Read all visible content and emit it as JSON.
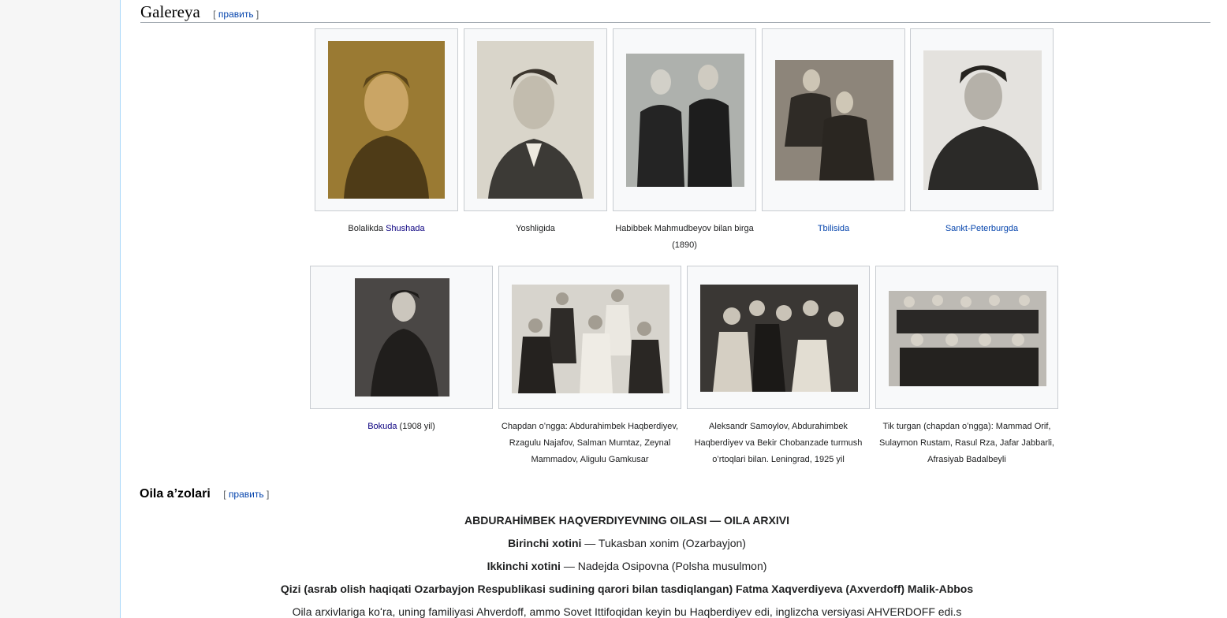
{
  "gallery": {
    "heading": "Galereya",
    "edit": "править",
    "items": [
      {
        "pre": "Bolalikda ",
        "link": "Shushada",
        "post": ""
      },
      {
        "pre": "Yoshligida",
        "link": "",
        "post": ""
      },
      {
        "pre": "Habibbek Mahmudbeyov bilan birga (1890)",
        "link": "",
        "post": ""
      },
      {
        "pre": "",
        "link": "Tbilisida",
        "post": ""
      },
      {
        "pre": "",
        "link": "Sankt-Peterburgda",
        "post": ""
      },
      {
        "pre": "",
        "link": "Bokuda",
        "post": " (1908 yil)"
      },
      {
        "pre": "Chapdan oʻngga: Abdurahimbek Haqberdiyev, Rzagulu Najafov, Salman Mumtaz, Zeynal Mammadov, Aligulu Gamkusar",
        "link": "",
        "post": ""
      },
      {
        "pre": "Aleksandr Samoylov, Abdurahimbek Haqberdiyev va Bekir Chobanzade turmush oʻrtoqlari bilan. Leningrad, 1925 yil",
        "link": "",
        "post": ""
      },
      {
        "pre": "Tik turgan (chapdan oʻngga): Mammad Orif, Sulaymon Rustam, Rasul Rza, Jafar Jabbarli, Afrasiyab Badalbeyli",
        "link": "",
        "post": ""
      }
    ]
  },
  "family": {
    "heading": "Oila a’zolari",
    "edit": "править",
    "title": "ABDURAHİMBEK HAQVERDIYEVNING OILASI — OILA ARXIVI",
    "wife1_label": "Birinchi xotini",
    "wife1_value": " — Tukasban xonim (Ozarbayjon)",
    "wife2_label": "Ikkinchi xotini",
    "wife2_value": " — Nadejda Osipovna (Polsha musulmon)",
    "daughter": "Qizi (asrab olish haqiqati Ozarbayjon Respublikasi sudining qarori bilan tasdiqlangan) Fatma Xaqverdiyeva (Axverdoff) Malik-Abbos",
    "archive_note": "Oila arxivlariga koʻra, uning familiyasi Ahverdoff, ammo Sovet Ittifoqidan keyin bu Haqberdiyev edi, inglizcha versiyasi AHVERDOFF edi.s"
  },
  "colors": {
    "link": "#0645ad",
    "border": "#c8ccd1",
    "thumb_bg": "#f8f9fa"
  }
}
